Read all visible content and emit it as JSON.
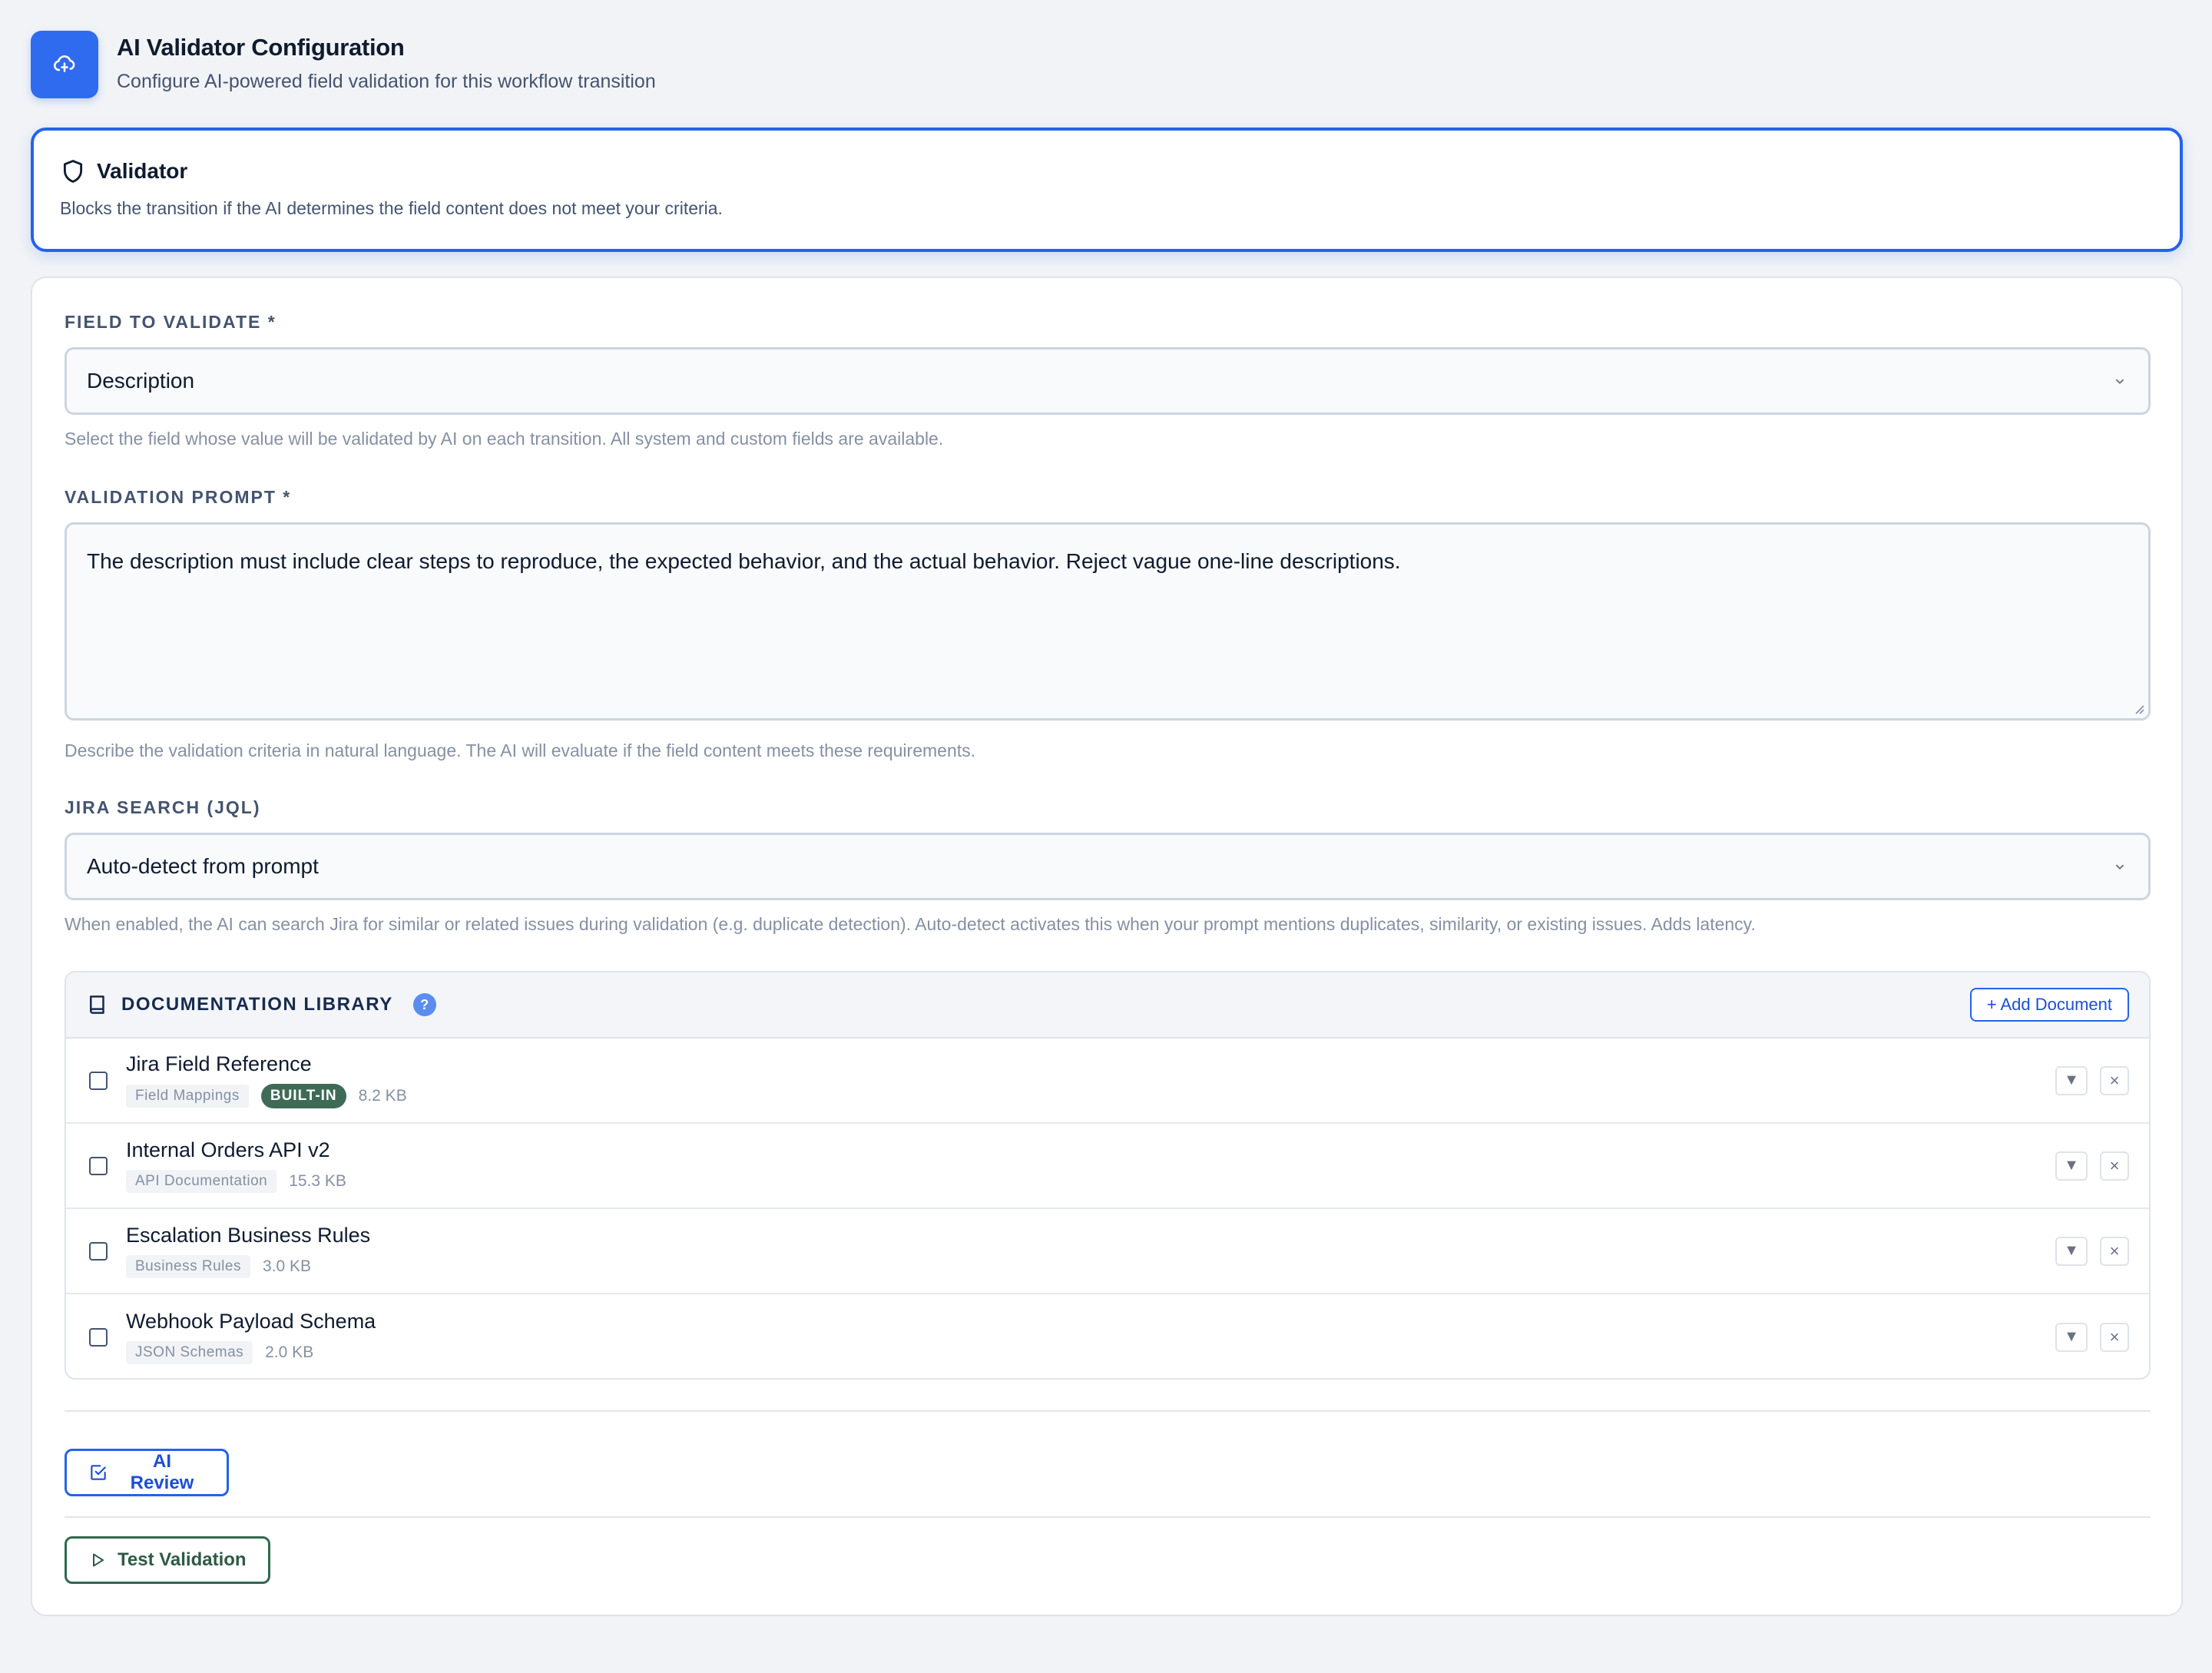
{
  "header": {
    "title": "AI Validator Configuration",
    "subtitle": "Configure AI-powered field validation for this workflow transition",
    "logo_icon": "cloud-sparkle-icon",
    "accent": "#2f6bef"
  },
  "mode": {
    "title": "Validator",
    "description": "Blocks the transition if the AI determines the field content does not meet your criteria.",
    "icon": "shield-icon"
  },
  "field_to_validate": {
    "label": "FIELD TO VALIDATE *",
    "value": "Description",
    "helper": "Select the field whose value will be validated by AI on each transition. All system and custom fields are available."
  },
  "validation_prompt": {
    "label": "VALIDATION PROMPT *",
    "value": "The description must include clear steps to reproduce, the expected behavior, and the actual behavior. Reject vague one-line descriptions.",
    "helper": "Describe the validation criteria in natural language. The AI will evaluate if the field content meets these requirements."
  },
  "jira_search": {
    "label": "JIRA SEARCH (JQL)",
    "value": "Auto-detect from prompt",
    "helper": "When enabled, the AI can search Jira for similar or related issues during validation (e.g. duplicate detection). Auto-detect activates this when your prompt mentions duplicates, similarity, or existing issues. Adds latency."
  },
  "doc_library": {
    "title": "DOCUMENTATION LIBRARY",
    "help": "?",
    "add_label": "+ Add Document",
    "items": [
      {
        "name": "Jira Field Reference",
        "tag": "Field Mappings",
        "badge": "BUILT-IN",
        "size": "8.2 KB"
      },
      {
        "name": "Internal Orders API v2",
        "tag": "API Documentation",
        "badge": "",
        "size": "15.3 KB"
      },
      {
        "name": "Escalation Business Rules",
        "tag": "Business Rules",
        "badge": "",
        "size": "3.0 KB"
      },
      {
        "name": "Webhook Payload Schema",
        "tag": "JSON Schemas",
        "badge": "",
        "size": "2.0 KB"
      }
    ],
    "expand_glyph": "▼",
    "remove_glyph": "×"
  },
  "actions": {
    "ai_review": "AI Review",
    "test_validation": "Test Validation"
  }
}
